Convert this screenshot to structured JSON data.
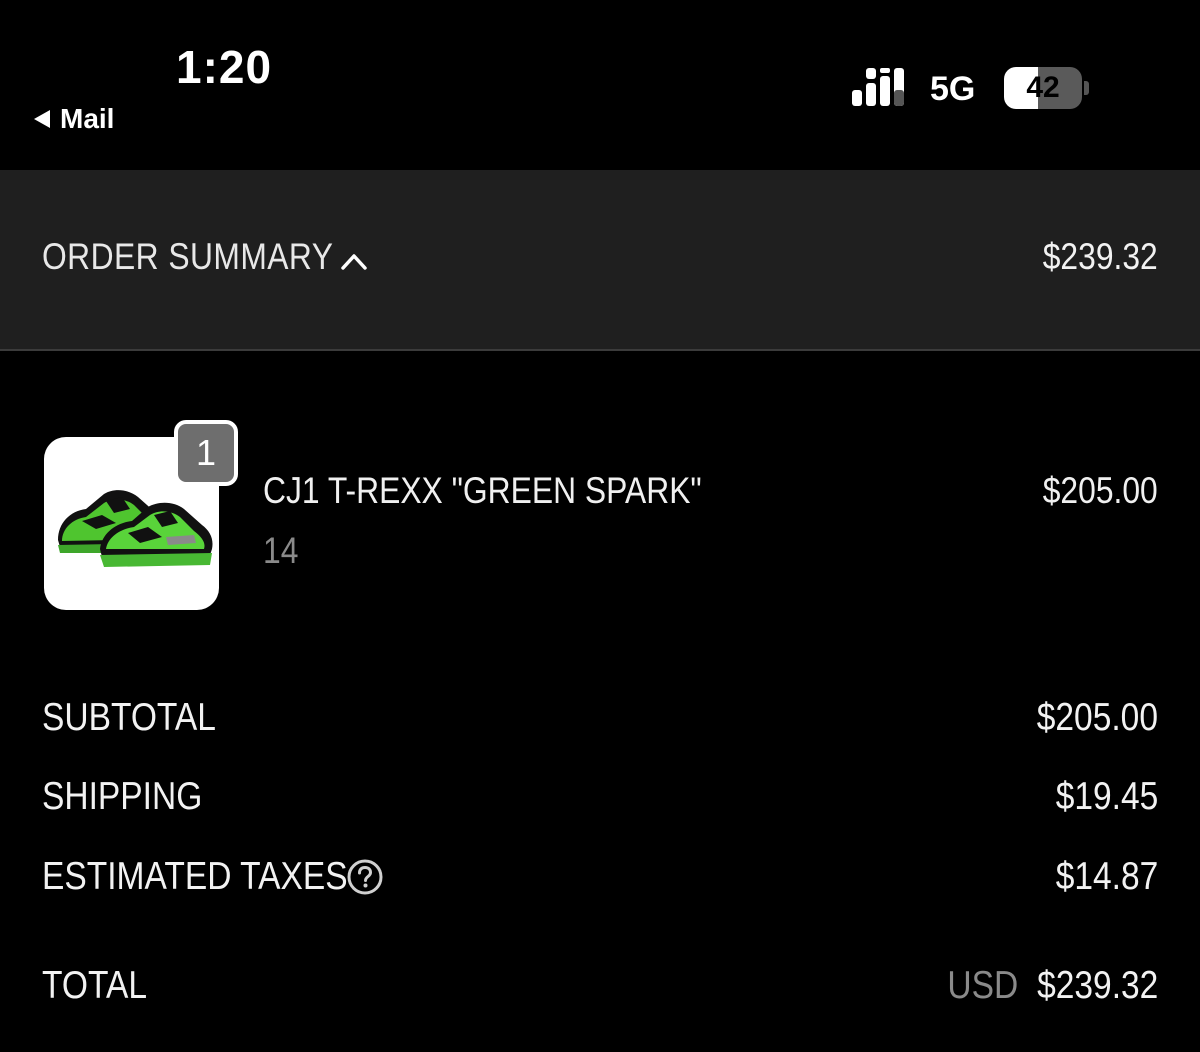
{
  "status_bar": {
    "time": "1:20",
    "back_label": "Mail",
    "network": "5G",
    "battery": "42"
  },
  "order_summary": {
    "title": "ORDER SUMMARY",
    "total": "$239.32",
    "expanded": true
  },
  "item": {
    "quantity": "1",
    "name": "CJ1 T-REXX \"GREEN SPARK\"",
    "size": "14",
    "price": "$205.00",
    "image_icon": "sneaker-image"
  },
  "totals": {
    "subtotal_label": "SUBTOTAL",
    "subtotal_value": "$205.00",
    "shipping_label": "SHIPPING",
    "shipping_value": "$19.45",
    "taxes_label": "ESTIMATED TAXES",
    "taxes_value": "$14.87",
    "total_label": "TOTAL",
    "total_currency": "USD",
    "total_value": "$239.32"
  },
  "colors": {
    "background": "#000000",
    "summary_bar": "#1f1f1f",
    "muted_text": "#8a8a8a",
    "shoe_green": "#4fc52f"
  }
}
